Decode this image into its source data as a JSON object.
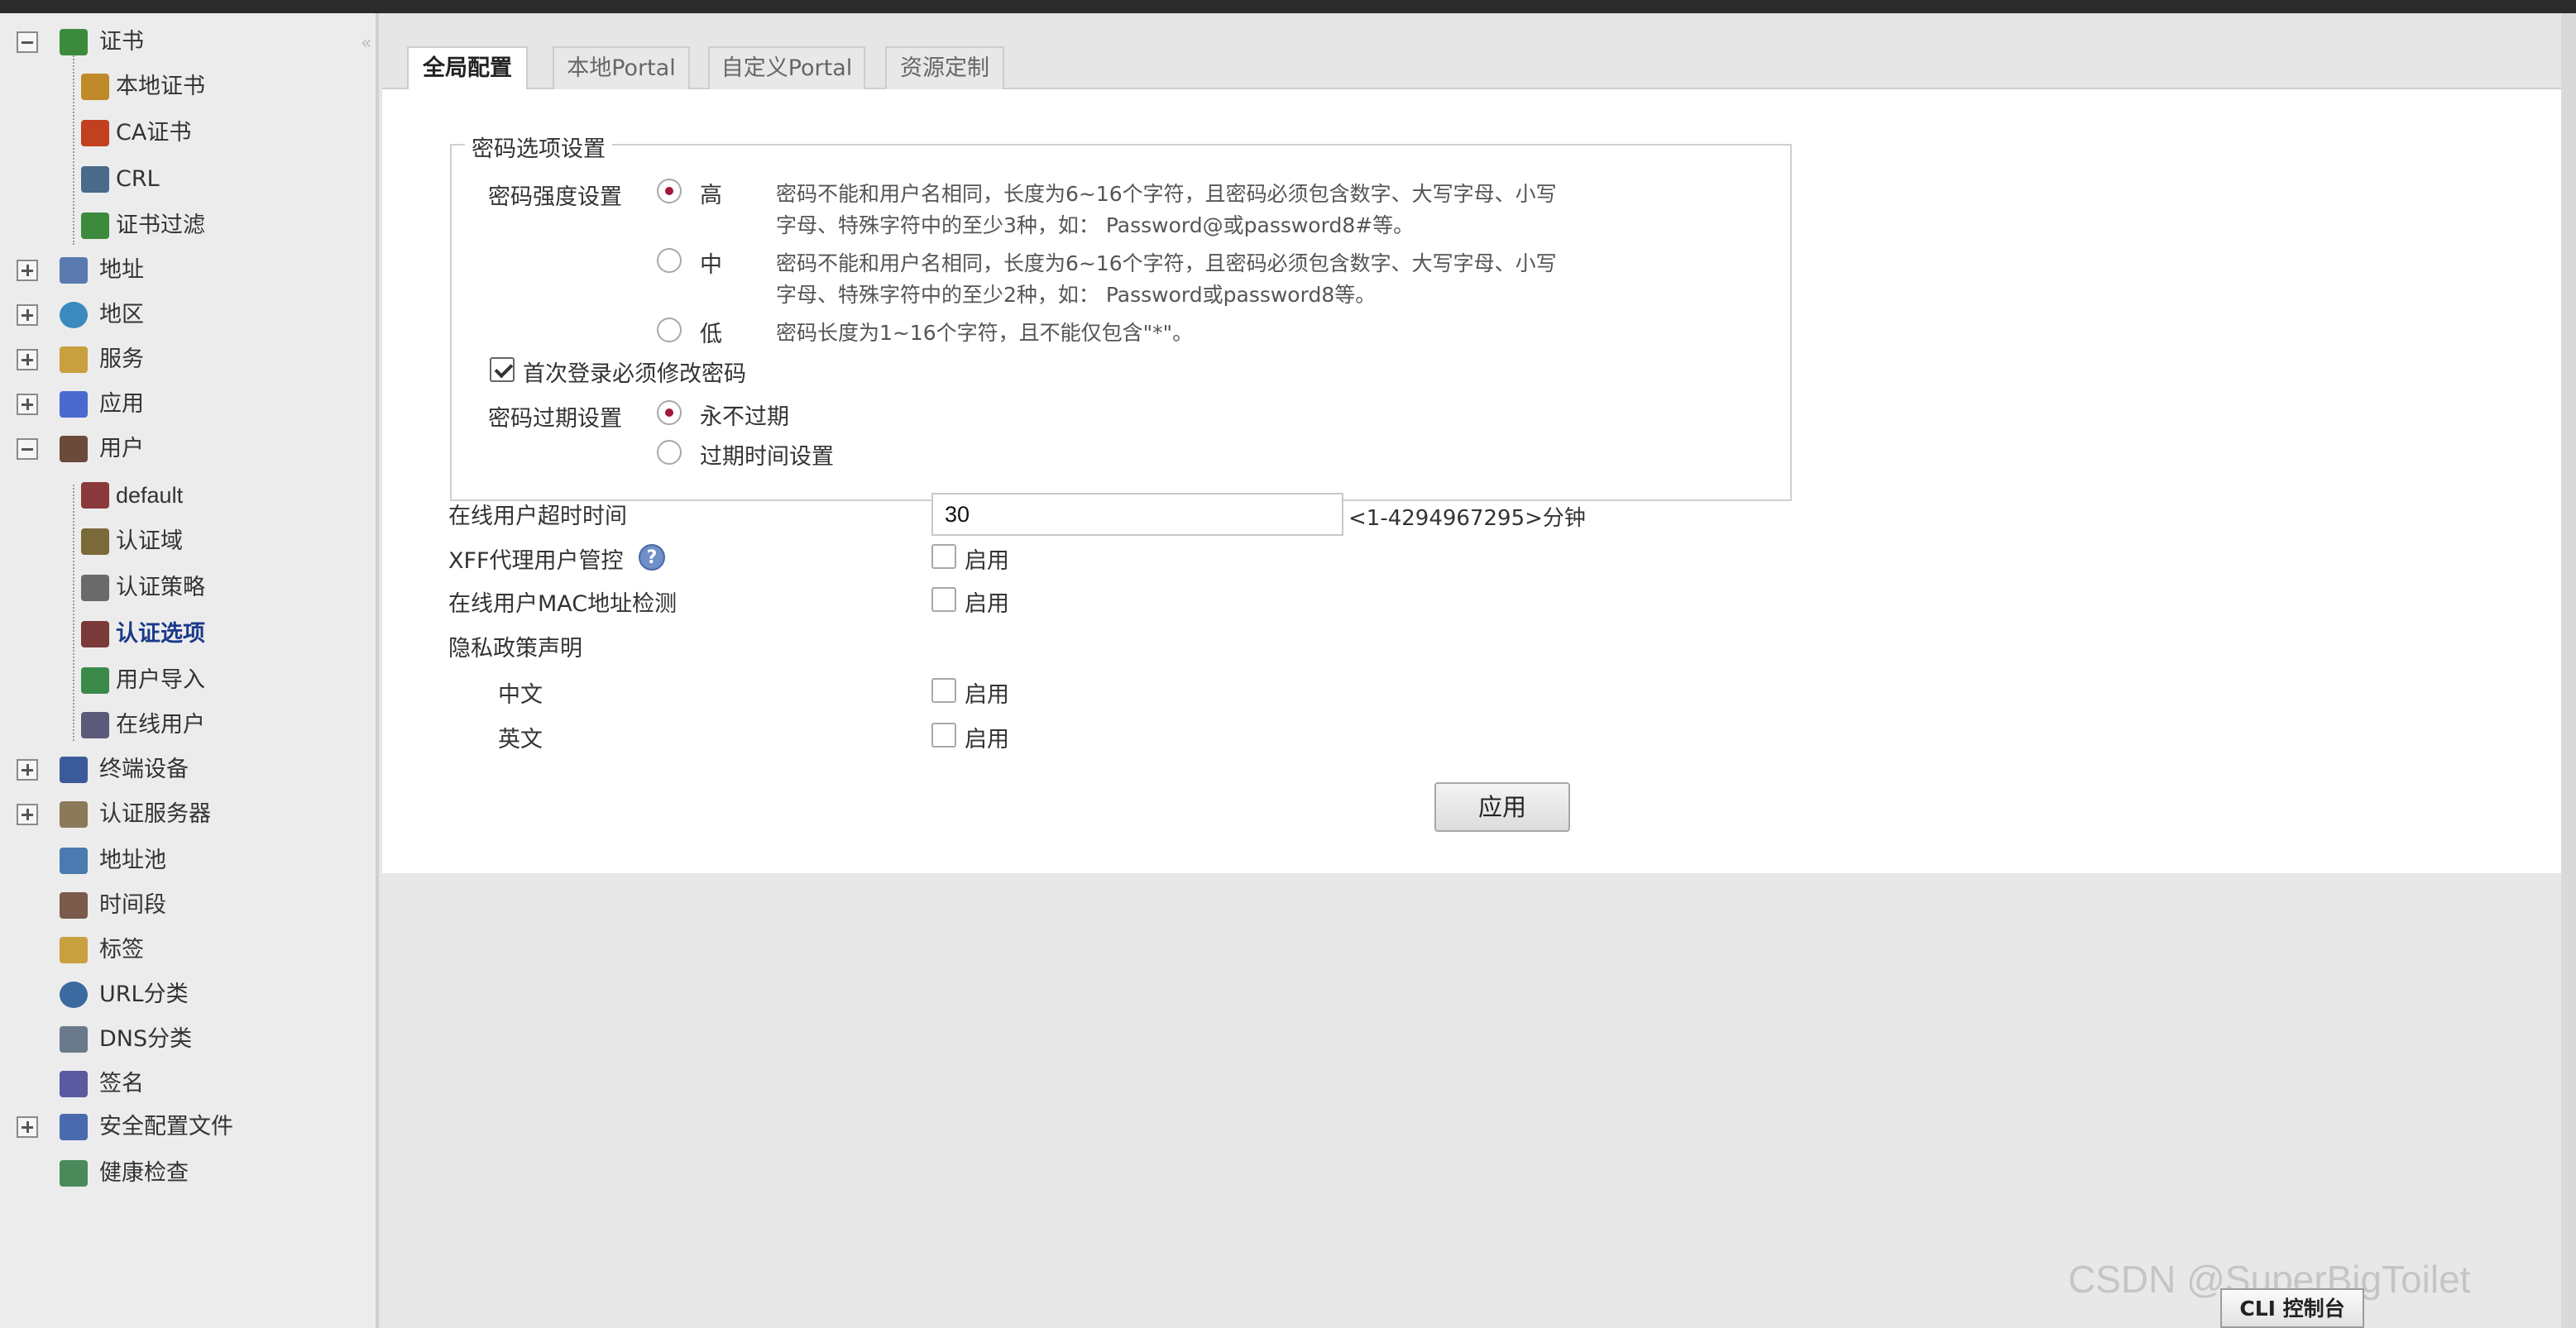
{
  "sidebar": {
    "items": [
      {
        "label": "证书",
        "expander": "minus",
        "icon": "certificate-icon",
        "color": "#3c8a3c"
      },
      {
        "label": "本地证书",
        "icon": "local-cert-icon",
        "color": "#c08a2a"
      },
      {
        "label": "CA证书",
        "icon": "ca-cert-icon",
        "color": "#c04020"
      },
      {
        "label": "CRL",
        "icon": "crl-icon",
        "color": "#4a6a8a"
      },
      {
        "label": "证书过滤",
        "icon": "cert-filter-icon",
        "color": "#3c8a3c"
      },
      {
        "label": "地址",
        "expander": "plus",
        "icon": "address-icon",
        "color": "#5a7ab0"
      },
      {
        "label": "地区",
        "expander": "plus",
        "icon": "globe-icon",
        "color": "#3a8ac0"
      },
      {
        "label": "服务",
        "expander": "plus",
        "icon": "service-icon",
        "color": "#c8a040"
      },
      {
        "label": "应用",
        "expander": "plus",
        "icon": "application-icon",
        "color": "#4a6ad0"
      },
      {
        "label": "用户",
        "expander": "minus",
        "icon": "user-icon",
        "color": "#6a4a3a"
      },
      {
        "label": "default",
        "icon": "default-user-icon",
        "color": "#8a3a3a"
      },
      {
        "label": "认证域",
        "icon": "auth-domain-icon",
        "color": "#7a6a3a"
      },
      {
        "label": "认证策略",
        "icon": "auth-policy-icon",
        "color": "#6a6a6a"
      },
      {
        "label": "认证选项",
        "icon": "auth-options-icon",
        "color": "#7a3a3a",
        "active": true
      },
      {
        "label": "用户导入",
        "icon": "user-import-icon",
        "color": "#3a8a4a"
      },
      {
        "label": "在线用户",
        "icon": "online-user-icon",
        "color": "#5a5a7a"
      },
      {
        "label": "终端设备",
        "expander": "plus",
        "icon": "terminal-device-icon",
        "color": "#3a5a9a"
      },
      {
        "label": "认证服务器",
        "expander": "plus",
        "icon": "auth-server-icon",
        "color": "#8a7a5a"
      },
      {
        "label": "地址池",
        "icon": "address-pool-icon",
        "color": "#4a7ab0"
      },
      {
        "label": "时间段",
        "icon": "schedule-icon",
        "color": "#7a5a4a"
      },
      {
        "label": "标签",
        "icon": "tag-icon",
        "color": "#c8a040"
      },
      {
        "label": "URL分类",
        "icon": "url-category-icon",
        "color": "#3a6aa0"
      },
      {
        "label": "DNS分类",
        "icon": "dns-category-icon",
        "color": "#6a7a8a"
      },
      {
        "label": "签名",
        "icon": "signature-icon",
        "color": "#5a5aa0"
      },
      {
        "label": "安全配置文件",
        "expander": "plus",
        "icon": "security-profile-icon",
        "color": "#4a6ab0"
      },
      {
        "label": "健康检查",
        "icon": "health-check-icon",
        "color": "#4a8a5a"
      }
    ]
  },
  "tabs": [
    {
      "label": "全局配置",
      "active": true
    },
    {
      "label": "本地Portal"
    },
    {
      "label": "自定义Portal"
    },
    {
      "label": "资源定制"
    }
  ],
  "password_options": {
    "legend": "密码选项设置",
    "strength_label": "密码强度设置",
    "strength_options": [
      {
        "label": "高",
        "selected": true,
        "desc_line1": "密码不能和用户名相同，长度为6~16个字符，且密码必须包含数字、大写字母、小写",
        "desc_line2": "字母、特殊字符中的至少3种，如： Password@或password8#等。"
      },
      {
        "label": "中",
        "selected": false,
        "desc_line1": "密码不能和用户名相同，长度为6~16个字符，且密码必须包含数字、大写字母、小写",
        "desc_line2": "字母、特殊字符中的至少2种，如： Password或password8等。"
      },
      {
        "label": "低",
        "selected": false,
        "desc_line1": "密码长度为1~16个字符，且不能仅包含\"*\"。",
        "desc_line2": ""
      }
    ],
    "first_login_label": "首次登录必须修改密码",
    "first_login_checked": true,
    "expiry_label": "密码过期设置",
    "expiry_options": [
      {
        "label": "永不过期",
        "selected": true
      },
      {
        "label": "过期时间设置",
        "selected": false
      }
    ]
  },
  "online_timeout": {
    "label": "在线用户超时时间",
    "value": "30",
    "range": "<1-4294967295>分钟"
  },
  "xff": {
    "label": "XFF代理用户管控",
    "help": "?",
    "checkbox_label": "启用",
    "checked": false
  },
  "mac_check": {
    "label": "在线用户MAC地址检测",
    "checkbox_label": "启用",
    "checked": false
  },
  "privacy": {
    "label": "隐私政策声明",
    "chinese": {
      "label": "中文",
      "checkbox_label": "启用",
      "checked": false
    },
    "english": {
      "label": "英文",
      "checkbox_label": "启用",
      "checked": false
    }
  },
  "apply_label": "应用",
  "watermark": "CSDN @SuperBigToilet",
  "cli_label": "CLI 控制台"
}
